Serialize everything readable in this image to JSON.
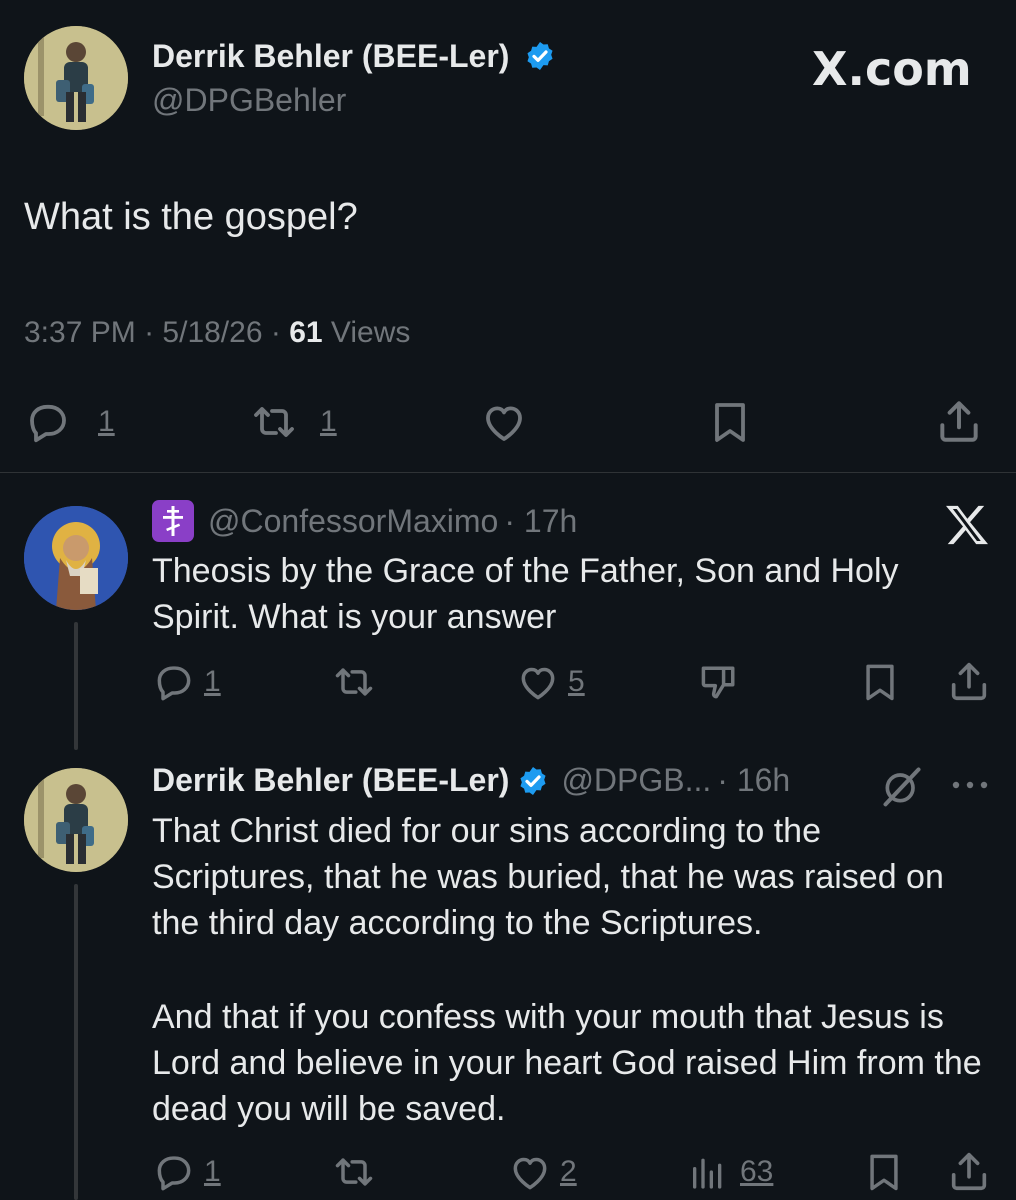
{
  "main_post": {
    "author_name": "Derrik Behler (BEE-Ler)",
    "handle": "@DPGBehler",
    "brand_label": "X.com",
    "text": "What is the gospel?",
    "time": "3:37 PM",
    "date": "5/18/26",
    "views_count": "61",
    "views_label": "Views",
    "separator": "·",
    "reply_count": "1",
    "repost_count": "1"
  },
  "reply_1": {
    "badge_icon": "orthodox-cross-badge",
    "handle": "@ConfessorMaximo",
    "age": "· 17h",
    "text": "Theosis by the Grace of the Father, Son and Holy Spirit. What is your answer",
    "reply_count": "1",
    "like_count": "5"
  },
  "reply_2": {
    "author_name": "Derrik Behler (BEE-Ler)",
    "handle": "@DPGB...",
    "age": "· 16h",
    "paragraph_1": "That Christ died for our sins according to the Scriptures, that he was buried, that he was raised on the third day according to the Scriptures.",
    "paragraph_2": "And that if you confess with your mouth that Jesus is Lord and believe in your heart God raised Him from the dead you will be saved.",
    "reply_count": "1",
    "like_count": "2",
    "views_count": "63"
  },
  "colors": {
    "background": "#0f1419",
    "text": "#e7e9ea",
    "muted": "#71767b",
    "verified": "#1d9bf0",
    "badge": "#8a3fc7"
  }
}
